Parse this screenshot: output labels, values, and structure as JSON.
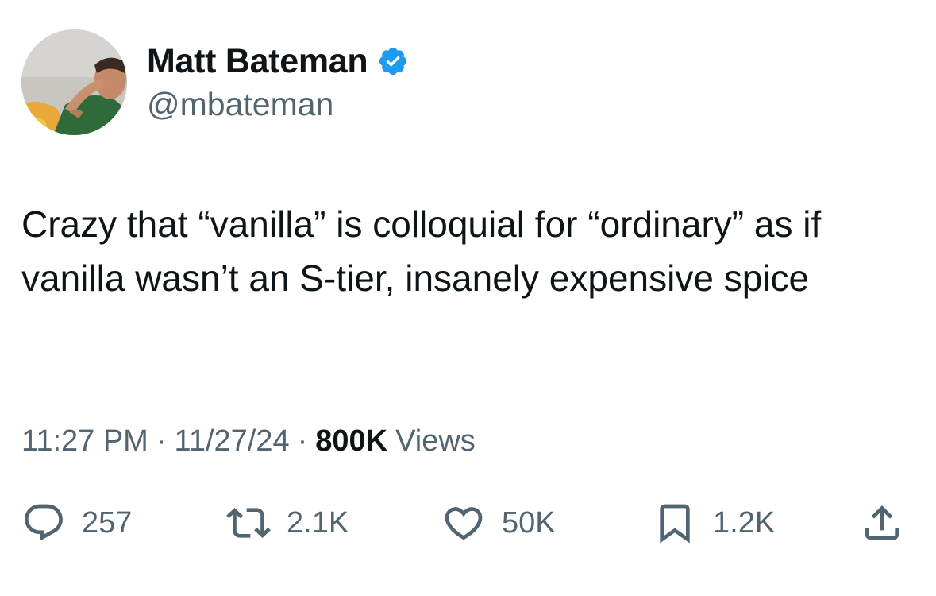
{
  "author": {
    "display_name": "Matt Bateman",
    "handle": "@mbateman",
    "verified": true,
    "avatar_icon": "profile-photo",
    "verified_color": "#1d9bf0"
  },
  "tweet": {
    "text": "Crazy that “vanilla” is colloquial for “ordinary” as if vanilla wasn’t an S-tier, insanely expensive spice"
  },
  "meta": {
    "time": "11:27 PM",
    "separator": "·",
    "date": "11/27/24",
    "views_count": "800K",
    "views_label": "Views"
  },
  "actions": {
    "reply": {
      "icon": "reply-icon",
      "count": "257"
    },
    "retweet": {
      "icon": "retweet-icon",
      "count": "2.1K"
    },
    "like": {
      "icon": "heart-icon",
      "count": "50K"
    },
    "bookmark": {
      "icon": "bookmark-icon",
      "count": "1.2K"
    },
    "share": {
      "icon": "share-icon"
    }
  },
  "colors": {
    "text_primary": "#0f1419",
    "text_secondary": "#536471",
    "icon": "#536471"
  }
}
